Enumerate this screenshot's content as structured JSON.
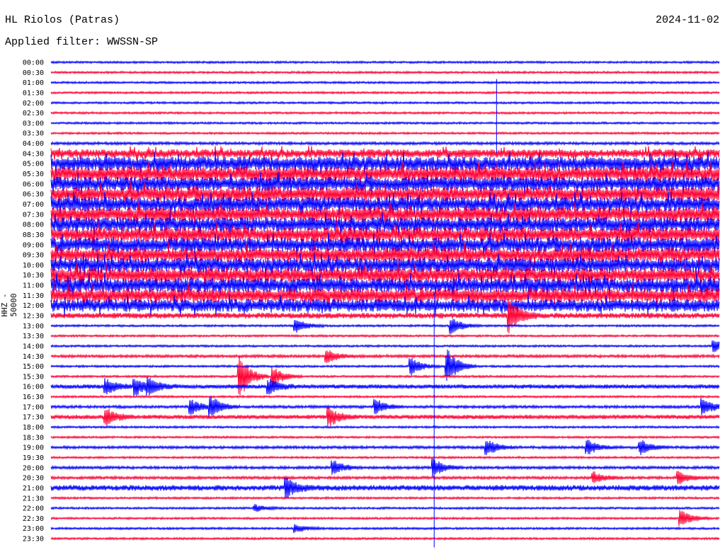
{
  "header": {
    "station": "HL Riolos (Patras)",
    "filter": "Applied filter: WWSSN-SP",
    "date": "2024-11-02"
  },
  "chart_data": {
    "type": "line",
    "title": "HL Riolos (Patras)",
    "subtitle": "Applied filter: WWSSN-SP",
    "date": "2024-11-02",
    "ylabel": "HHZ - 50000",
    "row_minutes": 30,
    "row_labels": [
      "00:00",
      "00:30",
      "01:00",
      "01:30",
      "02:00",
      "02:30",
      "03:00",
      "03:30",
      "04:00",
      "04:30",
      "05:00",
      "05:30",
      "06:00",
      "06:30",
      "07:00",
      "07:30",
      "08:00",
      "08:30",
      "09:00",
      "09:30",
      "10:00",
      "10:30",
      "11:00",
      "11:30",
      "12:00",
      "12:30",
      "13:00",
      "13:30",
      "14:00",
      "14:30",
      "15:00",
      "15:30",
      "16:00",
      "16:30",
      "17:00",
      "17:30",
      "18:00",
      "18:30",
      "19:00",
      "19:30",
      "20:00",
      "20:30",
      "21:00",
      "21:30",
      "22:00",
      "22:30",
      "23:00",
      "23:30"
    ],
    "series_colors": [
      "#0000ff",
      "#ff0033"
    ],
    "noise_level": [
      1.5,
      1.5,
      1.5,
      1.5,
      1.5,
      1.5,
      1.5,
      1.5,
      2,
      6,
      10,
      10,
      10,
      10,
      10,
      10,
      10,
      10,
      10,
      10,
      10,
      10,
      10,
      10,
      9,
      4,
      1.5,
      1.5,
      1.5,
      2,
      1.5,
      1.5,
      3,
      1.5,
      2,
      3,
      1.5,
      1.5,
      2,
      1.5,
      2,
      2,
      4,
      1.5,
      1.5,
      1.5,
      1.5,
      1.5
    ],
    "events": [
      {
        "row": 25,
        "minute": 20.6,
        "amp": 22
      },
      {
        "row": 26,
        "minute": 11,
        "amp": 10
      },
      {
        "row": 26,
        "minute": 18,
        "amp": 12
      },
      {
        "row": 28,
        "minute": 29.8,
        "amp": 8
      },
      {
        "row": 29,
        "minute": 12.4,
        "amp": 10
      },
      {
        "row": 30,
        "minute": 17.8,
        "amp": 25
      },
      {
        "row": 30,
        "minute": 16.2,
        "amp": 12
      },
      {
        "row": 31,
        "minute": 8.5,
        "amp": 30
      },
      {
        "row": 31,
        "minute": 10,
        "amp": 14
      },
      {
        "row": 32,
        "minute": 2.5,
        "amp": 10
      },
      {
        "row": 32,
        "minute": 3.8,
        "amp": 12
      },
      {
        "row": 32,
        "minute": 4.4,
        "amp": 10
      },
      {
        "row": 32,
        "minute": 9.8,
        "amp": 10
      },
      {
        "row": 34,
        "minute": 6.3,
        "amp": 10
      },
      {
        "row": 34,
        "minute": 7.2,
        "amp": 15
      },
      {
        "row": 34,
        "minute": 14.6,
        "amp": 10
      },
      {
        "row": 34,
        "minute": 29.3,
        "amp": 12
      },
      {
        "row": 35,
        "minute": 2.5,
        "amp": 12
      },
      {
        "row": 35,
        "minute": 12.5,
        "amp": 12
      },
      {
        "row": 38,
        "minute": 19.6,
        "amp": 12
      },
      {
        "row": 38,
        "minute": 24.1,
        "amp": 10
      },
      {
        "row": 38,
        "minute": 26.5,
        "amp": 10
      },
      {
        "row": 40,
        "minute": 12.7,
        "amp": 10
      },
      {
        "row": 40,
        "minute": 17.2,
        "amp": 12
      },
      {
        "row": 41,
        "minute": 24.4,
        "amp": 8
      },
      {
        "row": 41,
        "minute": 28.2,
        "amp": 8
      },
      {
        "row": 42,
        "minute": 10.6,
        "amp": 12
      },
      {
        "row": 44,
        "minute": 9.2,
        "amp": 5
      },
      {
        "row": 45,
        "minute": 28.3,
        "amp": 12
      },
      {
        "row": 46,
        "minute": 11,
        "amp": 6
      }
    ],
    "spikes": [
      {
        "row": 2,
        "minute": 20,
        "up": 5,
        "down": 100
      },
      {
        "row": 36,
        "minute": 17.2,
        "up": 190,
        "down": 170
      }
    ]
  }
}
